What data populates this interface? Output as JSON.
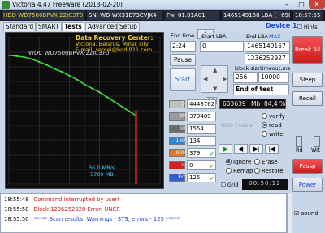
{
  "window": {
    "title": "Victoria 4.47   Freeware (2013-02-20)",
    "minimize": "–",
    "maximize": "□",
    "close": "✕"
  },
  "infobar": {
    "model": "HDD WD7500BPVX-22JC3T0",
    "serial": "SN: WD-WX31E73CVJK4",
    "firmware": "Fw: 01.01A01",
    "lba": "1465149168 LBA (~698 GB)",
    "clock": "18:57:55"
  },
  "tabs": [
    "Standard",
    "SMART",
    "Tests",
    "Advanced",
    "Setup"
  ],
  "active_tab": "Tests",
  "device_label": "Device 1",
  "hints_label": "Hints",
  "graph": {
    "drive_label": "WDC WD7500BPVX-22JC3T0",
    "dr_title": "Data Recovery Center:",
    "dr_location": "Victoria, Belarus, Minsk city",
    "dr_email": "E-mail: sergei@hdd-911.com",
    "speed_line": "36,0 MB/s",
    "time_line": "5709 MB"
  },
  "controls": {
    "end_time_label": "End time",
    "end_time": "2:24",
    "spin_value": "6",
    "start_lba_label": "Start LBA:",
    "start_lba": "0",
    "end_lba_label": "End LBA:",
    "end_lba_max": "MAX",
    "end_lba": "1465149167",
    "current_lba": "1236252927",
    "pause": "Pause",
    "start": "Start",
    "block_size_label": "block size",
    "block_size": "256",
    "timeout_label": "timeout,ms",
    "timeout": "10000",
    "end_mode": "End of test"
  },
  "stats": [
    {
      "label": "5",
      "value": "4448762",
      "color": "#c0c0c0",
      "checked": ""
    },
    {
      "label": "20",
      "value": "379489",
      "color": "#9a9a9a",
      "checked": ""
    },
    {
      "label": "50",
      "value": "1554",
      "color": "#6a6a6a",
      "checked": ""
    },
    {
      "label": "150",
      "value": "134",
      "color": "#2f86d8",
      "checked": ""
    },
    {
      "label": "600",
      "value": "379",
      "color": "#e07a20",
      "checked": "✓"
    },
    {
      "label": ">",
      "value": "0",
      "color": "#d82020",
      "checked": "✓"
    },
    {
      "label": "Err",
      "value": "125",
      "color": "#2f5fd0",
      "checked": "✓"
    }
  ],
  "rs_button": "RS",
  "vertical_label": "to log",
  "progress": {
    "mb": "603639",
    "mb_unit": "Mb",
    "percent": "84,4",
    "percent_unit": "%"
  },
  "modes": [
    "verify",
    "read",
    "write"
  ],
  "active_mode": "read",
  "ddd_enable": "DDD Enable",
  "play_buttons": [
    "▶",
    "◀",
    "▶|",
    "|◀"
  ],
  "actions": [
    "Ignore",
    "Erase",
    "Remap",
    "Restore"
  ],
  "active_action": "Ignore",
  "grid_label": "Grid",
  "grid_value": "00:50:12",
  "right_buttons": {
    "break_all": "Break All",
    "sleep": "Sleep",
    "recall": "Recall",
    "passp": "Passp",
    "power": "Power",
    "rd": "Rd",
    "wrt": "Wrt",
    "sound": "sound"
  },
  "log": [
    {
      "time": "18:55:48",
      "text": "Command interrupted by user!",
      "color": "#d01818"
    },
    {
      "time": "18:55:50",
      "text": "Block 1236252928 Error: UNCR",
      "color": "#d01818"
    },
    {
      "time": "18:55:50",
      "text": "***** Scan results: Warnings - 379, errors - 125 *****",
      "color": "#1f3fd0"
    }
  ],
  "chart_data": {
    "type": "line",
    "series": [
      {
        "x": [
          0,
          5,
          10,
          15,
          20,
          25,
          30,
          35,
          40,
          45,
          50,
          55,
          60,
          65,
          70,
          75,
          80,
          84
        ],
        "values": [
          132,
          131,
          130,
          128,
          125,
          122,
          118,
          115,
          111,
          107,
          102,
          98,
          94,
          89,
          84,
          79,
          74,
          70
        ]
      }
    ],
    "error_markers": [
      84
    ],
    "ylim": [
      0,
      150
    ],
    "xlim": [
      0,
      100
    ],
    "grid": true
  }
}
